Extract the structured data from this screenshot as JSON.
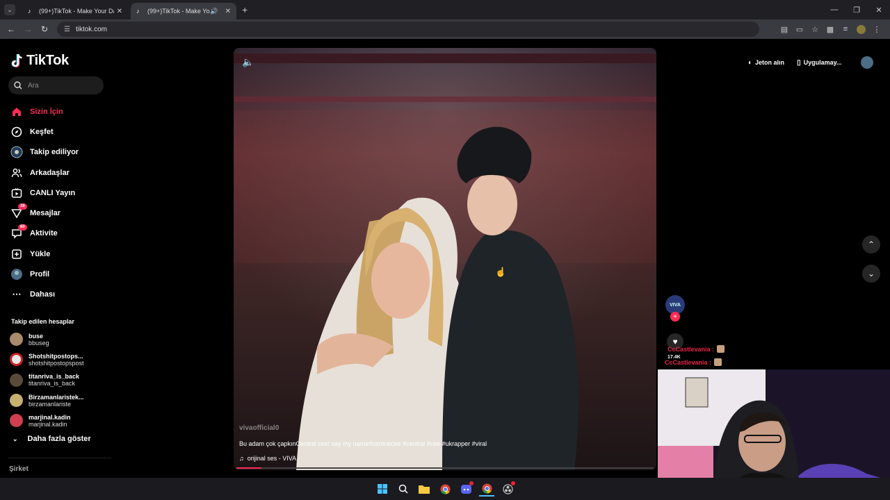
{
  "browser": {
    "tabs": [
      {
        "title": "(99+)TikTok - Make Your Day",
        "active": false
      },
      {
        "title": "(99+)TikTok - Make Your Da",
        "active": true
      }
    ],
    "url": "tiktok.com"
  },
  "sidebar": {
    "logo": "TikTok",
    "search_placeholder": "Ara",
    "nav": [
      {
        "label": "Sizin İçin",
        "icon": "home-icon",
        "active": true
      },
      {
        "label": "Keşfet",
        "icon": "compass-icon"
      },
      {
        "label": "Takip ediliyor",
        "icon": "following-icon"
      },
      {
        "label": "Arkadaşlar",
        "icon": "friends-icon"
      },
      {
        "label": "CANLI Yayın",
        "icon": "live-icon"
      },
      {
        "label": "Mesajlar",
        "icon": "messages-icon",
        "badge": "38"
      },
      {
        "label": "Aktivite",
        "icon": "activity-icon",
        "badge": "80"
      },
      {
        "label": "Yükle",
        "icon": "upload-icon"
      },
      {
        "label": "Profil",
        "icon": "profile-icon"
      },
      {
        "label": "Dahası",
        "icon": "more-icon"
      }
    ],
    "following_title": "Takip edilen hesaplar",
    "following": [
      {
        "name": "buse",
        "handle": "bbuseg",
        "color": "#a98a6a"
      },
      {
        "name": "Shotshitpostops...",
        "handle": "shotshitpostopspost",
        "color": "#e8e8e8"
      },
      {
        "name": "titanriva_is_back",
        "handle": "titanriva_is_back",
        "color": "#5a4a3a"
      },
      {
        "name": "Birzamanlaristek...",
        "handle": "birzamanlariste",
        "color": "#c8b070"
      },
      {
        "name": "marjinal.kadin",
        "handle": "marjinal.kadin",
        "color": "#d04050"
      }
    ],
    "more_label": "Daha fazla göster",
    "company": "Şirket"
  },
  "video": {
    "username": "vivaofficial0",
    "description": "Bu adam çok çapkınCentral cee! say my name#centralcee #central #cee #ukrapper #viral",
    "music": "orijinal ses - VIVA",
    "progress": 0.06
  },
  "header": {
    "coins": "Jeton alın",
    "app": "Uygulamay..."
  },
  "actions": {
    "creator": "VIVA",
    "likes": "17.4K"
  },
  "chat": [
    {
      "user": "CcCastlevania",
      "sep": ":"
    },
    {
      "user": "CcCastlevania",
      "sep": ":"
    }
  ],
  "colors": {
    "accent": "#fe2c55",
    "background": "#000000"
  }
}
